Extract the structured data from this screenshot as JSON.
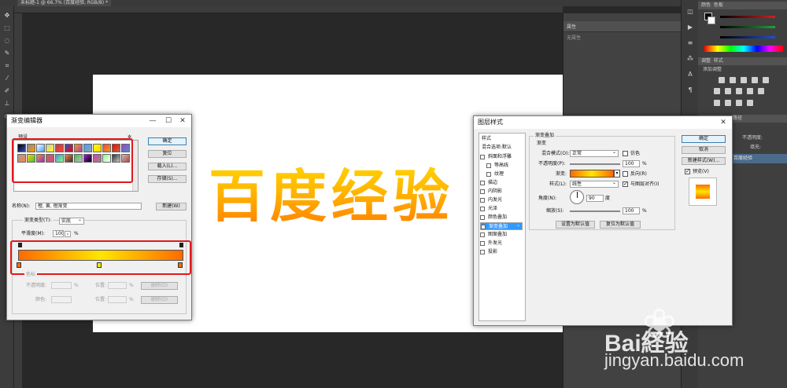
{
  "document": {
    "tab_title": "未标题-1 @ 66.7% (百度经验, RGB/8) *"
  },
  "canvas": {
    "text": "百度经验"
  },
  "properties_panel": {
    "title": "属性",
    "empty_text": "无属性"
  },
  "color_panel": {
    "tab1": "颜色",
    "tab2": "色板",
    "sliders": [
      "#d02020",
      "#20a040",
      "#2050d0"
    ]
  },
  "adjust_panel": {
    "tab1": "调整",
    "tab2": "样式",
    "hint": "添加调整"
  },
  "layers_panel": {
    "tab": "路径",
    "opacity_label": "不透明度:",
    "fill_label": "填充:",
    "layer_name": "百度经验"
  },
  "gradient_editor": {
    "title": "渐变编辑器",
    "presets_label": "预设",
    "buttons": {
      "ok": "确定",
      "reset": "复位",
      "load": "载入(L)...",
      "save": "存储(S)...",
      "new": "新建(W)"
    },
    "name_label": "名称(N):",
    "name_value": "橙, 黄, 橙渐变",
    "type_label": "渐变类型(T):",
    "type_value": "实底",
    "smooth_label": "平滑度(M):",
    "smooth_value": "100",
    "smooth_unit": "%",
    "stops_group": "色标",
    "opacity_label": "不透明度:",
    "location_label": "位置:",
    "color_label": "颜色:",
    "delete_label": "删除(D)",
    "unit": "%",
    "gradient_colors": [
      "#ff6a00",
      "#ffe600",
      "#ff6a00"
    ],
    "preset_swatches": [
      "#000000",
      "#8c8c8c",
      "#ffffff",
      "#c8c8c8",
      "#c04040",
      "#3050c0",
      "#ff9900",
      "#40a0ff",
      "#ffff00",
      "#ff4040",
      "#ff0000",
      "#a040c0",
      "#a0a0a0",
      "#ffd000",
      "#e0a020",
      "#b07040",
      "#5090d0",
      "#ff8040",
      "#40c040",
      "#a020e0",
      "#e040a0",
      "#80ff80",
      "#303030",
      "#c0c0c0"
    ]
  },
  "layer_style": {
    "title": "图层样式",
    "styles_header": "样式",
    "blend_options": "混合选项:默认",
    "items": [
      "斜面和浮雕",
      "等高线",
      "纹理",
      "描边",
      "内阴影",
      "内发光",
      "光泽",
      "颜色叠加",
      "渐变叠加",
      "图案叠加",
      "外发光",
      "投影"
    ],
    "selected_item": "渐变叠加",
    "section_title": "渐变叠加",
    "sub_title": "渐变",
    "blend_mode_label": "混合模式(O):",
    "blend_mode_value": "正常",
    "dither_label": "仿色",
    "opacity_label": "不透明度(P):",
    "opacity_value": "100",
    "unit": "%",
    "gradient_label": "渐变:",
    "reverse_label": "反向(R)",
    "style_label": "样式(L):",
    "style_value": "线性",
    "align_label": "与图层对齐(I)",
    "angle_label": "角度(N):",
    "angle_value": "90",
    "angle_unit": "度",
    "scale_label": "缩放(S):",
    "scale_value": "100",
    "set_default": "设置为默认值",
    "reset_default": "复位为默认值",
    "buttons": {
      "ok": "确定",
      "cancel": "取消",
      "new_style": "新建样式(W)...",
      "preview": "预览(V)"
    }
  },
  "watermark": {
    "brand": "Bai経验",
    "url": "jingyan.baidu.com"
  }
}
